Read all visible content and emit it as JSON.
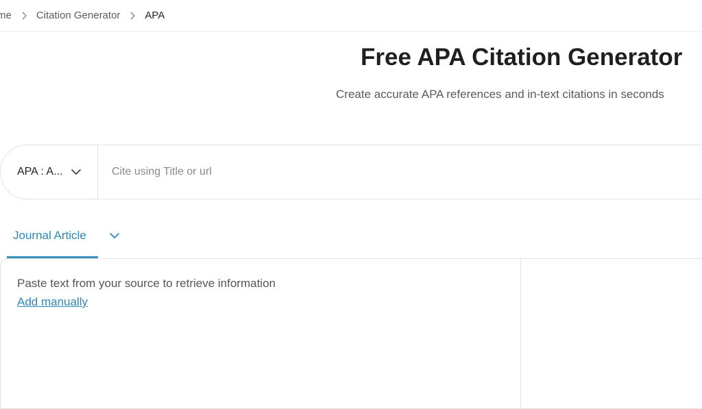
{
  "breadcrumb": {
    "home": "me",
    "item1": "Citation Generator",
    "current": "APA"
  },
  "header": {
    "title": "Free APA Citation Generator",
    "subtitle": "Create accurate APA references and in-text citations in seconds"
  },
  "search": {
    "style_selected": "APA : A...",
    "placeholder": "Cite using Title or url"
  },
  "tabs": {
    "active_label": "Journal Article"
  },
  "panel": {
    "hint": "Paste text from your source to retrieve information",
    "add_manually": "Add manually"
  },
  "colors": {
    "accent": "#2f86b7",
    "tab_underline": "#3a8fbf"
  }
}
